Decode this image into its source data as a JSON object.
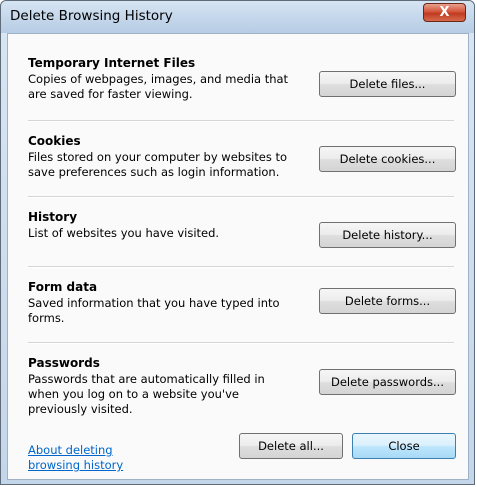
{
  "window": {
    "title": "Delete Browsing History",
    "close_glyph": "X"
  },
  "sections": [
    {
      "title": "Temporary Internet Files",
      "description": "Copies of webpages, images, and media that are saved for faster viewing.",
      "button": "Delete files..."
    },
    {
      "title": "Cookies",
      "description": "Files stored on your computer by websites to save preferences such as login information.",
      "button": "Delete cookies..."
    },
    {
      "title": "History",
      "description": "List of websites you have visited.",
      "button": "Delete history..."
    },
    {
      "title": "Form data",
      "description": "Saved information that you have typed into forms.",
      "button": "Delete forms..."
    },
    {
      "title": "Passwords",
      "description": "Passwords that are automatically filled in when you log on to a website you've previously visited.",
      "button": "Delete passwords..."
    }
  ],
  "footer": {
    "link": "About deleting browsing history",
    "delete_all": "Delete all...",
    "close": "Close"
  }
}
